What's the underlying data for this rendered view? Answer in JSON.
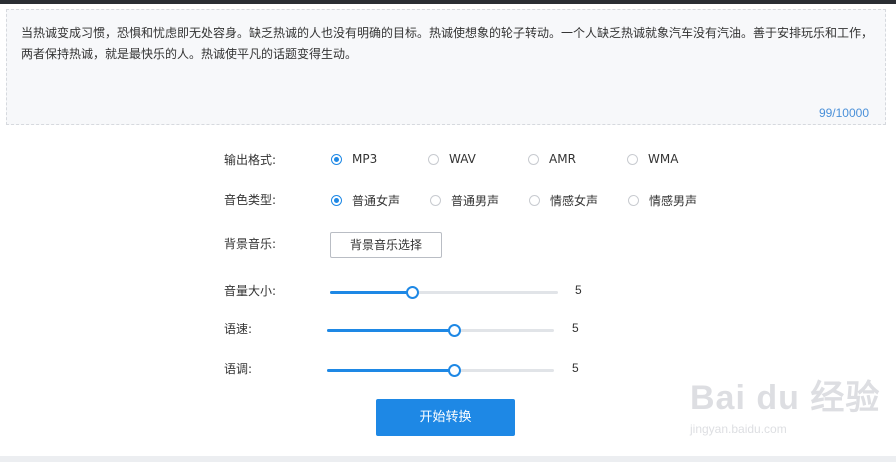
{
  "textarea": {
    "content": "当热诚变成习惯，恐惧和忧虑即无处容身。缺乏热诚的人也没有明确的目标。热诚使想象的轮子转动。一个人缺乏热诚就象汽车没有汽油。善于安排玩乐和工作，两者保持热诚，就是最快乐的人。热诚使平凡的话题变得生动。",
    "counter": "99/10000"
  },
  "format": {
    "label": "输出格式:",
    "options": [
      "MP3",
      "WAV",
      "AMR",
      "WMA"
    ],
    "selected": "MP3"
  },
  "voice": {
    "label": "音色类型:",
    "options": [
      "普通女声",
      "普通男声",
      "情感女声",
      "情感男声"
    ],
    "selected": "普通女声"
  },
  "bgm": {
    "label": "背景音乐:",
    "button": "背景音乐选择"
  },
  "sliders": {
    "volume": {
      "label": "音量大小:",
      "value": "5",
      "fraction": 0.36
    },
    "speed": {
      "label": "语速:",
      "value": "5",
      "fraction": 0.56
    },
    "pitch": {
      "label": "语调:",
      "value": "5",
      "fraction": 0.56
    }
  },
  "start_button": "开始转换",
  "watermark": {
    "logo": "Bai du 经验",
    "url": "jingyan.baidu.com"
  },
  "colors": {
    "accent": "#1e88e5",
    "counter": "#4a90d9"
  }
}
